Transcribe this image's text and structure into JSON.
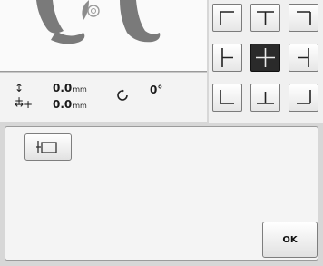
{
  "preview": {
    "description_icon": "embroidery-letter-preview"
  },
  "info": {
    "vertical": {
      "icon": "vertical-move-icon",
      "symbol": "↕ +",
      "value": "0.0",
      "unit": "mm"
    },
    "horizontal": {
      "icon": "horizontal-move-icon",
      "symbol": "↔+",
      "value": "0.0",
      "unit": "mm"
    },
    "rotation": {
      "icon": "rotate-icon",
      "value": "0°"
    }
  },
  "position_grid": {
    "cells": [
      {
        "name": "top-left"
      },
      {
        "name": "top-center"
      },
      {
        "name": "top-right"
      },
      {
        "name": "middle-left"
      },
      {
        "name": "center",
        "selected": true
      },
      {
        "name": "middle-right"
      },
      {
        "name": "bottom-left"
      },
      {
        "name": "bottom-center"
      },
      {
        "name": "bottom-right"
      }
    ]
  },
  "buttons": {
    "frame_button_icon": "frame-position-icon",
    "ok_label": "OK"
  }
}
